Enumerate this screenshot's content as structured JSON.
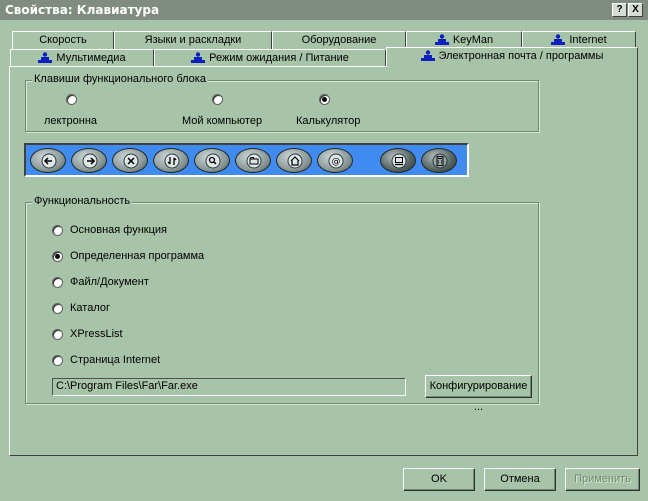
{
  "window": {
    "title": "Свойства: Клавиатура",
    "help_label": "?",
    "close_label": "X"
  },
  "tabs": {
    "row1": [
      {
        "label": "Скорость"
      },
      {
        "label": "Языки и раскладки"
      },
      {
        "label": "Оборудование"
      },
      {
        "label": "KeyMan"
      },
      {
        "label": "Internet"
      }
    ],
    "row2": [
      {
        "label": "Мультимедиа"
      },
      {
        "label": "Режим ожидания / Питание"
      },
      {
        "label": "Электронная почта / программы",
        "active": true
      }
    ]
  },
  "function_keys": {
    "title": "Клавиши функционального блока",
    "options": [
      {
        "label": "лектронна",
        "selected": false
      },
      {
        "label": "Мой компьютер",
        "selected": false
      },
      {
        "label": "Калькулятор",
        "selected": true
      }
    ]
  },
  "keys": [
    "back-icon",
    "forward-icon",
    "stop-icon",
    "refresh-icon",
    "search-icon",
    "favorites-icon",
    "home-icon",
    "email-icon",
    "my-computer-icon",
    "calculator-icon"
  ],
  "functionality": {
    "title": "Функциональность",
    "options": [
      {
        "label": "Основная функция",
        "selected": false
      },
      {
        "label": "Определенная программа",
        "selected": true
      },
      {
        "label": "Файл/Документ",
        "selected": false
      },
      {
        "label": "Каталог",
        "selected": false
      },
      {
        "label": "XPressList",
        "selected": false
      },
      {
        "label": "Страница Internet",
        "selected": false
      }
    ],
    "path_value": "C:\\Program Files\\Far\\Far.exe",
    "configure_label": "Конфигурирование ..."
  },
  "footer": {
    "ok_label": "OK",
    "cancel_label": "Отмена",
    "apply_label": "Применить"
  },
  "colors": {
    "background": "#a8c4a8",
    "keybar": "#3f8bef",
    "titlebar": "#808c80"
  }
}
